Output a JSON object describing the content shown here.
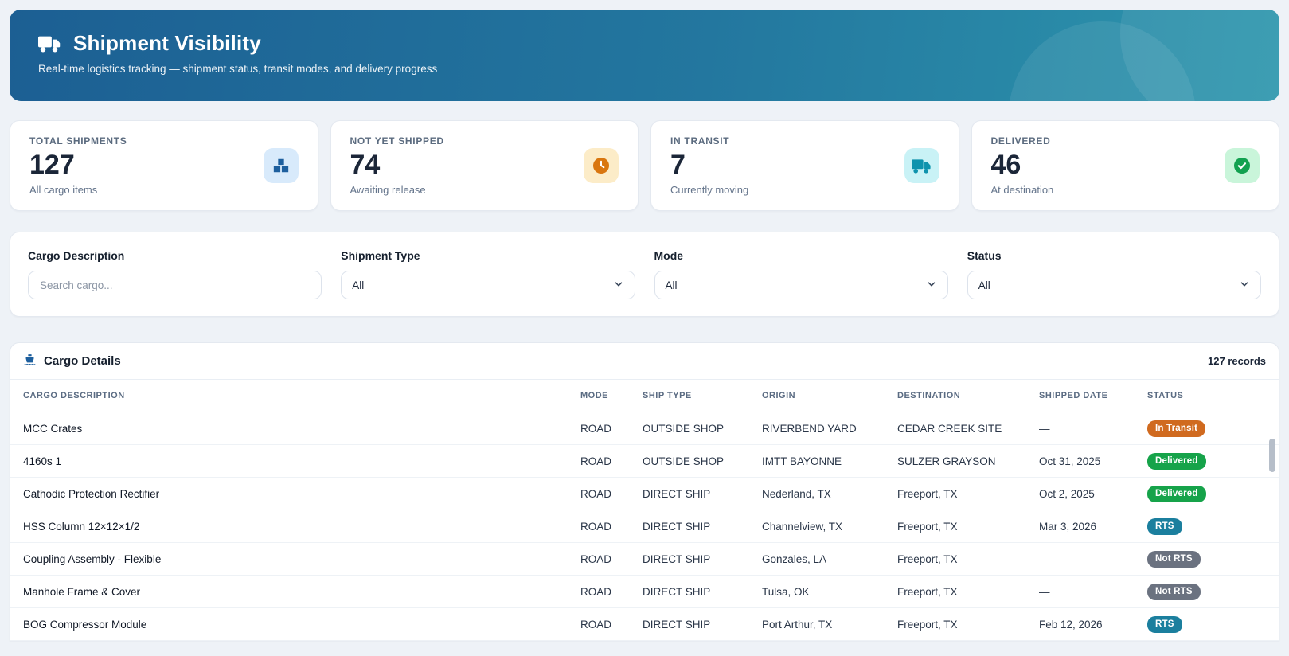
{
  "banner": {
    "title": "Shipment Visibility",
    "subtitle": "Real-time logistics tracking — shipment status, transit modes, and delivery progress"
  },
  "stats": [
    {
      "label": "TOTAL SHIPMENTS",
      "value": "127",
      "sublabel": "All cargo items",
      "icon": "boxes-icon",
      "accent": "#1d5f9e",
      "accent_bg": "#d8eafb"
    },
    {
      "label": "NOT YET SHIPPED",
      "value": "74",
      "sublabel": "Awaiting release",
      "icon": "clock-icon",
      "accent": "#d9760f",
      "accent_bg": "#fcecc8"
    },
    {
      "label": "IN TRANSIT",
      "value": "7",
      "sublabel": "Currently moving",
      "icon": "truck-icon",
      "accent": "#0e93ad",
      "accent_bg": "#c9f2f6"
    },
    {
      "label": "DELIVERED",
      "value": "46",
      "sublabel": "At destination",
      "icon": "check-circle-icon",
      "accent": "#12a150",
      "accent_bg": "#c9f5da"
    }
  ],
  "filters": {
    "search": {
      "label": "Cargo Description",
      "placeholder": "Search cargo..."
    },
    "shipment_type": {
      "label": "Shipment Type",
      "value": "All"
    },
    "mode": {
      "label": "Mode",
      "value": "All"
    },
    "status": {
      "label": "Status",
      "value": "All"
    }
  },
  "table": {
    "title": "Cargo Details",
    "records": "127 records",
    "columns": [
      "CARGO DESCRIPTION",
      "MODE",
      "SHIP TYPE",
      "ORIGIN",
      "DESTINATION",
      "SHIPPED DATE",
      "STATUS"
    ],
    "badge_colors": {
      "in-transit": "#d06a1f",
      "delivered": "#16a34a",
      "rts": "#1b7f9e",
      "not-rts": "#6b7280"
    },
    "rows": [
      {
        "description": "MCC Crates",
        "mode": "ROAD",
        "ship_type": "OUTSIDE SHOP",
        "origin": "RIVERBEND YARD",
        "destination": "CEDAR CREEK SITE",
        "shipped_date": "—",
        "status": "In Transit",
        "status_key": "in-transit"
      },
      {
        "description": "4160s 1",
        "mode": "ROAD",
        "ship_type": "OUTSIDE SHOP",
        "origin": "IMTT BAYONNE",
        "destination": "SULZER GRAYSON",
        "shipped_date": "Oct 31, 2025",
        "status": "Delivered",
        "status_key": "delivered"
      },
      {
        "description": "Cathodic Protection Rectifier",
        "mode": "ROAD",
        "ship_type": "DIRECT SHIP",
        "origin": "Nederland, TX",
        "destination": "Freeport, TX",
        "shipped_date": "Oct 2, 2025",
        "status": "Delivered",
        "status_key": "delivered"
      },
      {
        "description": "HSS Column 12×12×1/2",
        "mode": "ROAD",
        "ship_type": "DIRECT SHIP",
        "origin": "Channelview, TX",
        "destination": "Freeport, TX",
        "shipped_date": "Mar 3, 2026",
        "status": "RTS",
        "status_key": "rts"
      },
      {
        "description": "Coupling Assembly - Flexible",
        "mode": "ROAD",
        "ship_type": "DIRECT SHIP",
        "origin": "Gonzales, LA",
        "destination": "Freeport, TX",
        "shipped_date": "—",
        "status": "Not RTS",
        "status_key": "not-rts"
      },
      {
        "description": "Manhole Frame & Cover",
        "mode": "ROAD",
        "ship_type": "DIRECT SHIP",
        "origin": "Tulsa, OK",
        "destination": "Freeport, TX",
        "shipped_date": "—",
        "status": "Not RTS",
        "status_key": "not-rts"
      },
      {
        "description": "BOG Compressor Module",
        "mode": "ROAD",
        "ship_type": "DIRECT SHIP",
        "origin": "Port Arthur, TX",
        "destination": "Freeport, TX",
        "shipped_date": "Feb 12, 2026",
        "status": "RTS",
        "status_key": "rts"
      }
    ]
  }
}
